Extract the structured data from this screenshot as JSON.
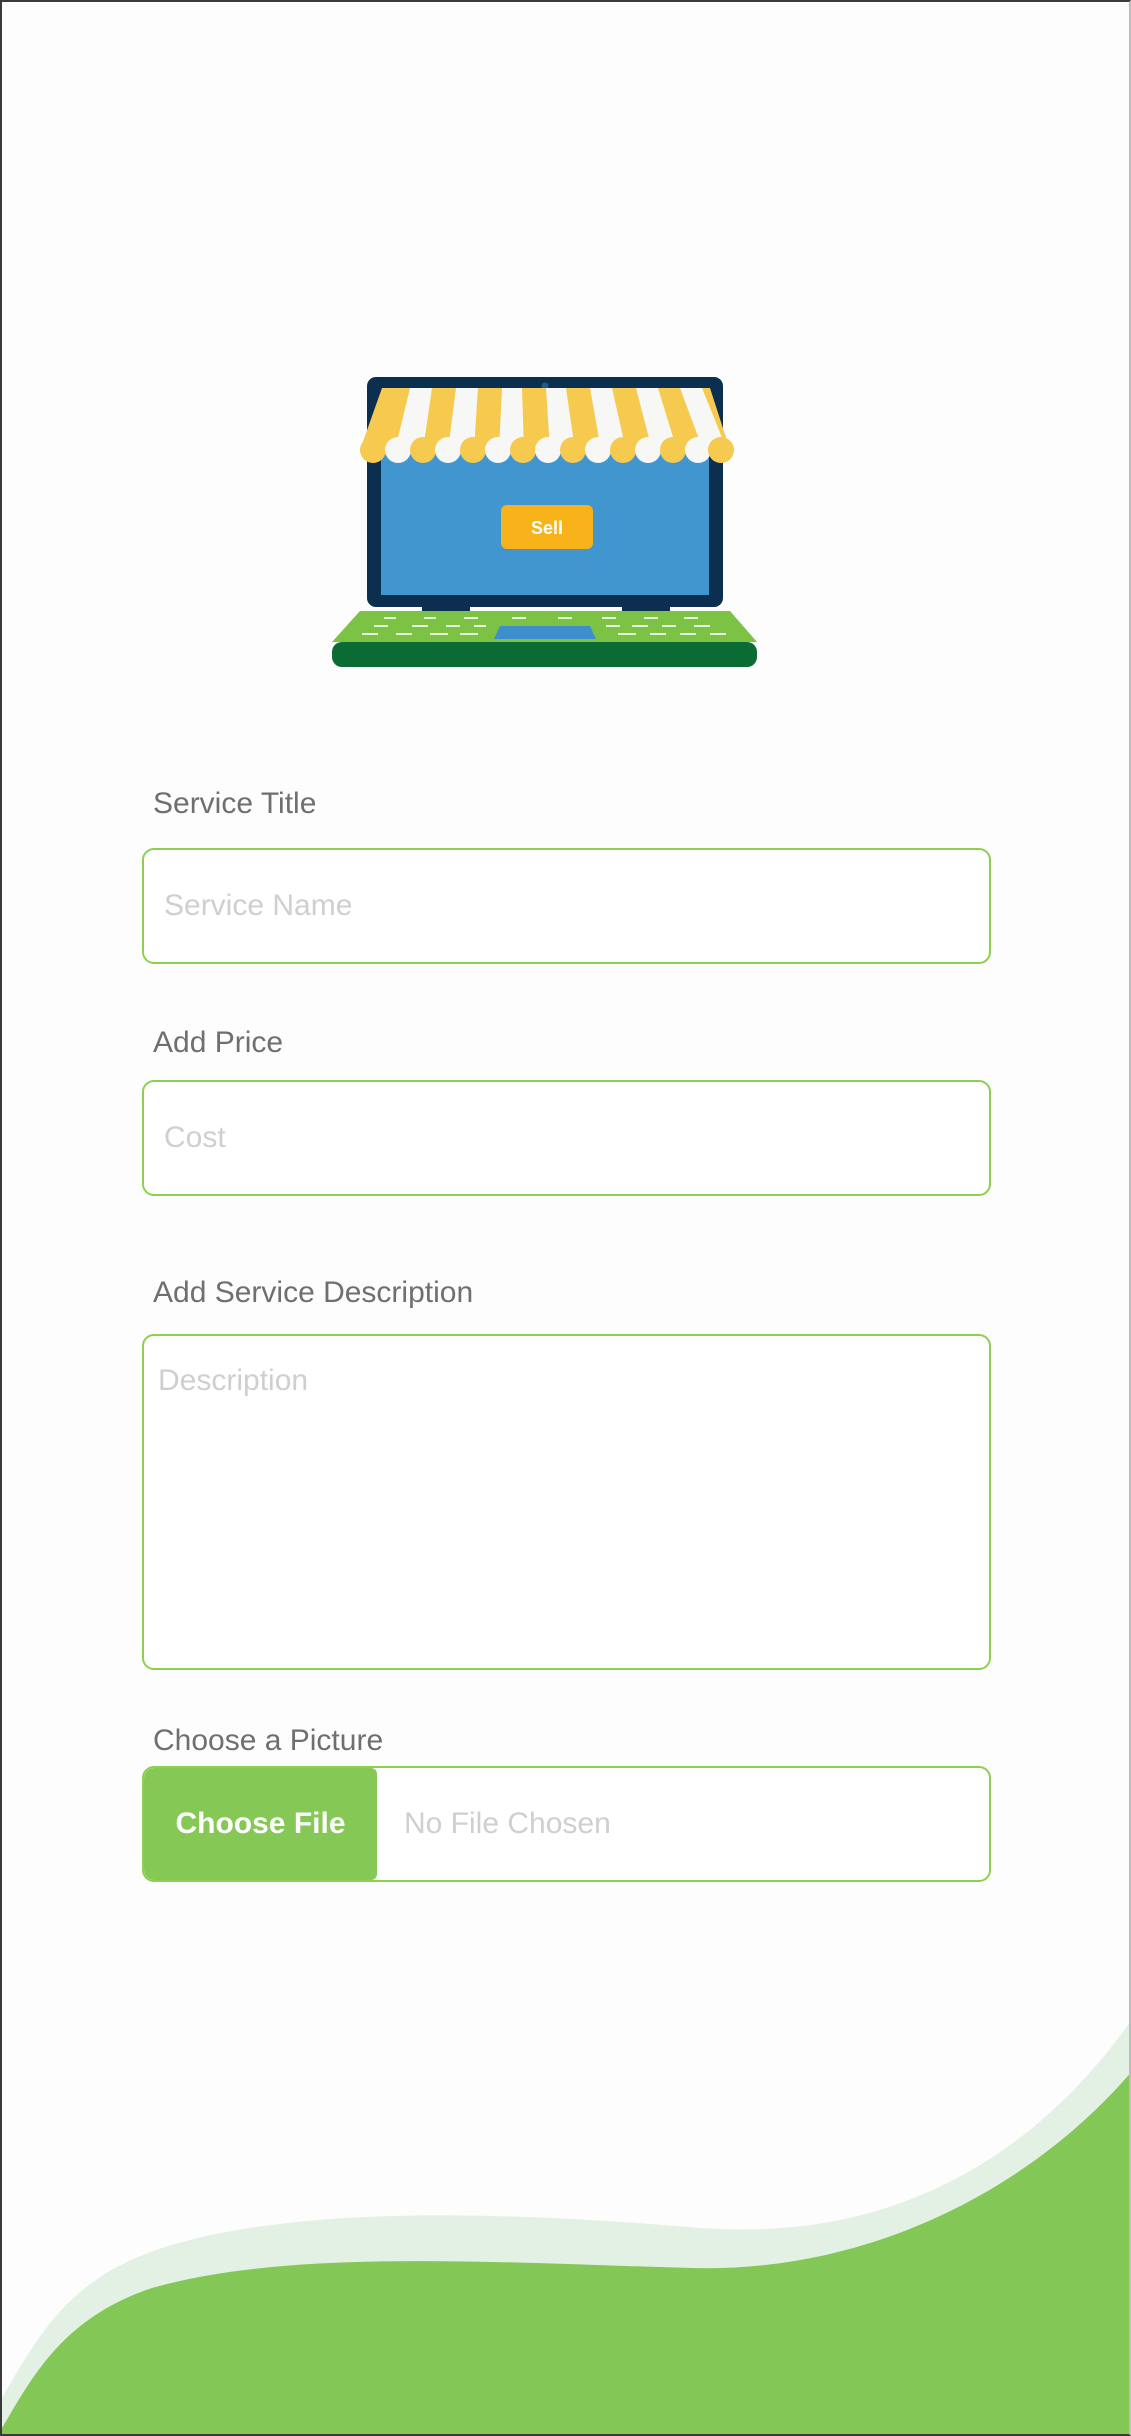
{
  "hero": {
    "sell_label": "Sell"
  },
  "form": {
    "title": {
      "label": "Service Title",
      "placeholder": "Service Name",
      "value": ""
    },
    "price": {
      "label": "Add Price",
      "placeholder": "Cost",
      "value": ""
    },
    "description": {
      "label": "Add Service Description",
      "placeholder": "Description",
      "value": ""
    },
    "picture": {
      "label": "Choose a Picture",
      "button_label": "Choose File",
      "status": "No File Chosen"
    }
  },
  "colors": {
    "accent_green": "#86c855",
    "border_green": "#8cd14d",
    "wave_light": "#e3f1e4",
    "label_gray": "#6f6f6f",
    "placeholder_gray": "#cfcfcf",
    "laptop_navy": "#0d2f4f",
    "screen_blue": "#4296d0",
    "awning_yellow": "#f6c94f",
    "sell_button_orange": "#f8b31b"
  },
  "icons": {
    "hero": "laptop-storefront-illustration"
  }
}
